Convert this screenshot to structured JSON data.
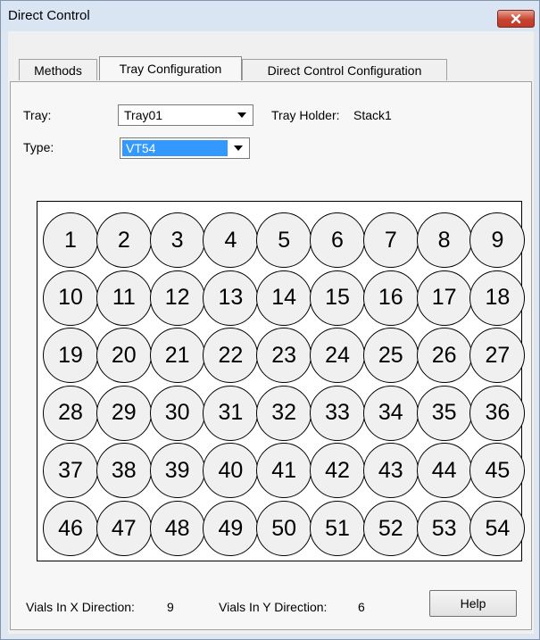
{
  "window": {
    "title": "Direct Control"
  },
  "colors": {
    "close_button": "#c7452f",
    "selection": "#3399ff",
    "title_bar": "#dae5f3"
  },
  "tabs": [
    {
      "label": "Methods",
      "active": false
    },
    {
      "label": "Tray Configuration",
      "active": true
    },
    {
      "label": "Direct Control Configuration",
      "active": false
    }
  ],
  "tray": {
    "label": "Tray:",
    "value": "Tray01"
  },
  "tray_holder": {
    "label": "Tray Holder:",
    "value": "Stack1"
  },
  "type": {
    "label": "Type:",
    "value": "VT54"
  },
  "vials": [
    "1",
    "2",
    "3",
    "4",
    "5",
    "6",
    "7",
    "8",
    "9",
    "10",
    "11",
    "12",
    "13",
    "14",
    "15",
    "16",
    "17",
    "18",
    "19",
    "20",
    "21",
    "22",
    "23",
    "24",
    "25",
    "26",
    "27",
    "28",
    "29",
    "30",
    "31",
    "32",
    "33",
    "34",
    "35",
    "36",
    "37",
    "38",
    "39",
    "40",
    "41",
    "42",
    "43",
    "44",
    "45",
    "46",
    "47",
    "48",
    "49",
    "50",
    "51",
    "52",
    "53",
    "54"
  ],
  "footer": {
    "x_label": "Vials In X Direction:",
    "x_value": "9",
    "y_label": "Vials In Y Direction:",
    "y_value": "6",
    "help_label": "Help"
  }
}
